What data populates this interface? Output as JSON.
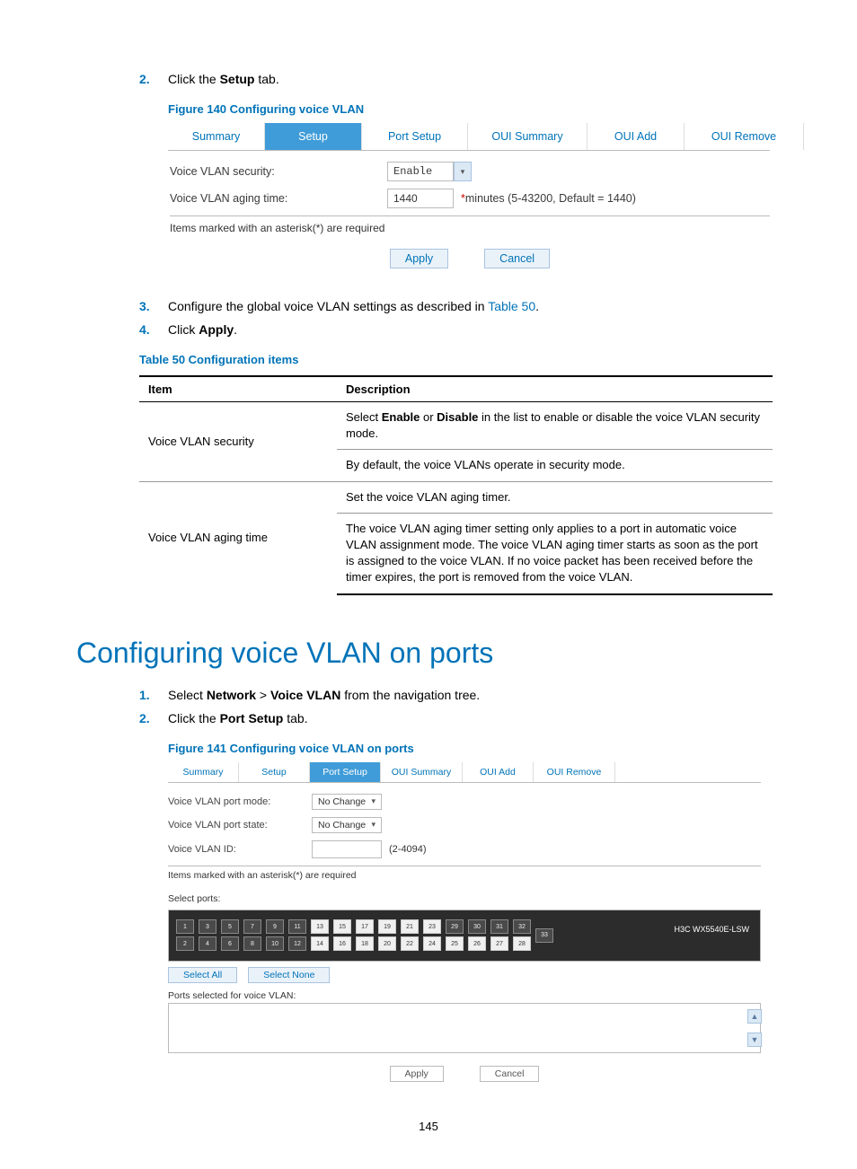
{
  "step2": {
    "num": "2.",
    "pre": "Click the ",
    "bold": "Setup",
    "post": " tab."
  },
  "fig140_caption": "Figure 140 Configuring voice VLAN",
  "fig140": {
    "tabs": [
      "Summary",
      "Setup",
      "Port Setup",
      "OUI Summary",
      "OUI Add",
      "OUI Remove"
    ],
    "security_label": "Voice VLAN security:",
    "security_value": "Enable",
    "aging_label": "Voice VLAN aging time:",
    "aging_value": "1440",
    "aging_unit_star": "*",
    "aging_unit": "minutes (5-43200, Default = 1440)",
    "note": "Items marked with an asterisk(*) are required",
    "apply": "Apply",
    "cancel": "Cancel"
  },
  "step3": {
    "num": "3.",
    "pre": "Configure the global voice VLAN settings as described in ",
    "link": "Table 50",
    "post": "."
  },
  "step4": {
    "num": "4.",
    "pre": "Click ",
    "bold": "Apply",
    "post": "."
  },
  "tbl50_caption": "Table 50 Configuration items",
  "tbl50": {
    "head_item": "Item",
    "head_desc": "Description",
    "row1_item": "Voice VLAN security",
    "row1_desc_top_pre": "Select ",
    "row1_desc_top_b1": "Enable",
    "row1_desc_top_mid": " or ",
    "row1_desc_top_b2": "Disable",
    "row1_desc_top_post": " in the list to enable or disable the voice VLAN security mode.",
    "row1_desc_bot": "By default, the voice VLANs operate in security mode.",
    "row2_item": "Voice VLAN aging time",
    "row2_desc_top": "Set the voice VLAN aging timer.",
    "row2_desc_bot": "The voice VLAN aging timer setting only applies to a port in automatic voice VLAN assignment mode. The voice VLAN aging timer starts as soon as the port is assigned to the voice VLAN. If no voice packet has been received before the timer expires, the port is removed from the voice VLAN."
  },
  "section_title": "Configuring voice VLAN on ports",
  "step_p1": {
    "num": "1.",
    "pre": "Select ",
    "b1": "Network",
    "gt": " > ",
    "b2": "Voice VLAN",
    "post": " from the navigation tree."
  },
  "step_p2": {
    "num": "2.",
    "pre": "Click the ",
    "bold": "Port Setup",
    "post": " tab."
  },
  "fig141_caption": "Figure 141 Configuring voice VLAN on ports",
  "fig141": {
    "tabs": [
      "Summary",
      "Setup",
      "Port Setup",
      "OUI Summary",
      "OUI Add",
      "OUI Remove"
    ],
    "mode_label": "Voice VLAN port mode:",
    "mode_value": "No Change",
    "state_label": "Voice VLAN port state:",
    "state_value": "No Change",
    "id_label": "Voice VLAN ID:",
    "id_range": "(2-4094)",
    "note": "Items marked with an asterisk(*) are required",
    "select_ports": "Select ports:",
    "top_ports": [
      "1",
      "3",
      "5",
      "7",
      "9",
      "11",
      "13",
      "15",
      "17",
      "19",
      "21",
      "23"
    ],
    "bot_ports": [
      "2",
      "4",
      "6",
      "8",
      "10",
      "12",
      "14",
      "16",
      "18",
      "20",
      "22",
      "24",
      "25",
      "26",
      "27",
      "28"
    ],
    "extra_top": [
      "29",
      "30",
      "31",
      "32",
      "33"
    ],
    "board": "H3C WX5540E-LSW",
    "select_all": "Select All",
    "select_none": "Select None",
    "selected_label": "Ports selected for voice VLAN:",
    "apply": "Apply",
    "cancel": "Cancel"
  },
  "page_number": "145"
}
